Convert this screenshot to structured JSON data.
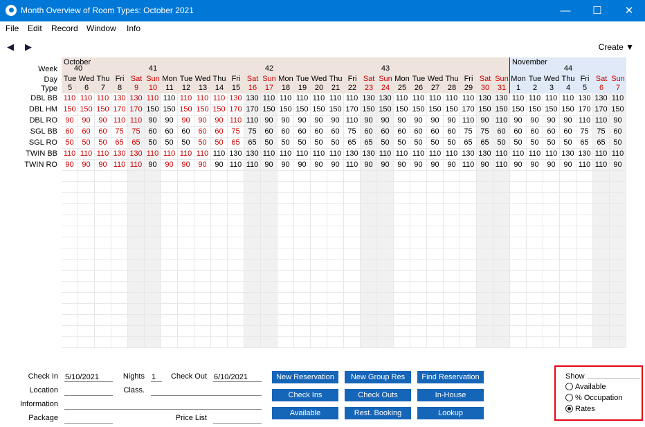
{
  "window": {
    "title": "Month Overview of Room Types: October 2021",
    "minimize": "—",
    "maximize": "☐",
    "close": "✕"
  },
  "menu": [
    "File",
    "Edit",
    "Record",
    "Window",
    "Info"
  ],
  "toolbar": {
    "prev": "◀",
    "next": "▶",
    "create": "Create ▼"
  },
  "grid": {
    "month1": "October",
    "month2": "November",
    "row_labels": {
      "week": "Week",
      "day": "Day",
      "type": "Type"
    },
    "weeks": [
      {
        "label": "40",
        "start": 0,
        "span": 2
      },
      {
        "label": "41",
        "start": 2,
        "span": 7
      },
      {
        "label": "42",
        "start": 9,
        "span": 7
      },
      {
        "label": "43",
        "start": 16,
        "span": 7
      },
      {
        "label": "44",
        "start": 27,
        "span": 7
      }
    ],
    "days": [
      {
        "d": "Tue",
        "n": "5"
      },
      {
        "d": "Wed",
        "n": "6"
      },
      {
        "d": "Thu",
        "n": "7"
      },
      {
        "d": "Fri",
        "n": "8"
      },
      {
        "d": "Sat",
        "n": "9"
      },
      {
        "d": "Sun",
        "n": "10"
      },
      {
        "d": "Mon",
        "n": "11"
      },
      {
        "d": "Tue",
        "n": "12"
      },
      {
        "d": "Wed",
        "n": "13"
      },
      {
        "d": "Thu",
        "n": "14"
      },
      {
        "d": "Fri",
        "n": "15"
      },
      {
        "d": "Sat",
        "n": "16"
      },
      {
        "d": "Sun",
        "n": "17"
      },
      {
        "d": "Mon",
        "n": "18"
      },
      {
        "d": "Tue",
        "n": "19"
      },
      {
        "d": "Wed",
        "n": "20"
      },
      {
        "d": "Thu",
        "n": "21"
      },
      {
        "d": "Fri",
        "n": "22"
      },
      {
        "d": "Sat",
        "n": "23"
      },
      {
        "d": "Sun",
        "n": "24"
      },
      {
        "d": "Mon",
        "n": "25"
      },
      {
        "d": "Tue",
        "n": "26"
      },
      {
        "d": "Wed",
        "n": "27"
      },
      {
        "d": "Thu",
        "n": "28"
      },
      {
        "d": "Fri",
        "n": "29"
      },
      {
        "d": "Sat",
        "n": "30"
      },
      {
        "d": "Sun",
        "n": "31"
      },
      {
        "d": "Mon",
        "n": "1"
      },
      {
        "d": "Tue",
        "n": "2"
      },
      {
        "d": "Wed",
        "n": "3"
      },
      {
        "d": "Thu",
        "n": "4"
      },
      {
        "d": "Fri",
        "n": "5"
      },
      {
        "d": "Sat",
        "n": "6"
      },
      {
        "d": "Sun",
        "n": "7"
      }
    ],
    "weekend_days": [
      4,
      5,
      11,
      12,
      18,
      19,
      25,
      26,
      32,
      33
    ],
    "rooms": [
      {
        "type": "DBL BB",
        "values": [
          "110",
          "110",
          "110",
          "130",
          "130",
          "110",
          "110",
          "110",
          "110",
          "110",
          "130",
          "130",
          "110",
          "110",
          "110",
          "110",
          "110",
          "110",
          "130",
          "130",
          "110",
          "110",
          "110",
          "110",
          "110",
          "130",
          "130",
          "110",
          "110",
          "110",
          "110",
          "130",
          "130",
          "110"
        ],
        "red": [
          0,
          1,
          2,
          3,
          4,
          5,
          7,
          8,
          9,
          10
        ]
      },
      {
        "type": "DBL HM",
        "values": [
          "150",
          "150",
          "150",
          "170",
          "170",
          "150",
          "150",
          "150",
          "150",
          "150",
          "170",
          "170",
          "150",
          "150",
          "150",
          "150",
          "150",
          "170",
          "150",
          "150",
          "150",
          "150",
          "150",
          "150",
          "170",
          "150",
          "150",
          "150",
          "150",
          "150",
          "150",
          "170",
          "170",
          "150"
        ],
        "red": [
          0,
          1,
          2,
          3,
          4,
          7,
          8,
          9,
          10
        ]
      },
      {
        "type": "DBL RO",
        "values": [
          "90",
          "90",
          "90",
          "110",
          "110",
          "90",
          "90",
          "90",
          "90",
          "90",
          "110",
          "110",
          "90",
          "90",
          "90",
          "90",
          "90",
          "110",
          "90",
          "90",
          "90",
          "90",
          "90",
          "90",
          "110",
          "90",
          "110",
          "90",
          "90",
          "90",
          "90",
          "110",
          "110",
          "90"
        ],
        "red": [
          0,
          1,
          2,
          3,
          4,
          7,
          8,
          9,
          10
        ]
      },
      {
        "type": "SGL BB",
        "values": [
          "60",
          "60",
          "60",
          "75",
          "75",
          "60",
          "60",
          "60",
          "60",
          "60",
          "75",
          "75",
          "60",
          "60",
          "60",
          "60",
          "60",
          "75",
          "60",
          "60",
          "60",
          "60",
          "60",
          "60",
          "75",
          "75",
          "60",
          "60",
          "60",
          "60",
          "60",
          "75",
          "75",
          "60"
        ],
        "red": [
          0,
          1,
          2,
          3,
          4,
          8,
          9,
          10
        ]
      },
      {
        "type": "SGL RO",
        "values": [
          "50",
          "50",
          "50",
          "65",
          "65",
          "50",
          "50",
          "50",
          "50",
          "50",
          "65",
          "65",
          "50",
          "50",
          "50",
          "50",
          "50",
          "65",
          "65",
          "50",
          "50",
          "50",
          "50",
          "50",
          "65",
          "65",
          "50",
          "50",
          "50",
          "50",
          "50",
          "65",
          "65",
          "50"
        ],
        "red": [
          0,
          1,
          2,
          3,
          4,
          8,
          9,
          10
        ]
      },
      {
        "type": "TWIN BB",
        "values": [
          "110",
          "110",
          "110",
          "130",
          "130",
          "110",
          "110",
          "110",
          "110",
          "110",
          "130",
          "130",
          "110",
          "110",
          "110",
          "110",
          "110",
          "130",
          "130",
          "110",
          "110",
          "110",
          "110",
          "110",
          "130",
          "130",
          "110",
          "110",
          "110",
          "110",
          "130",
          "130",
          "110",
          "110"
        ],
        "red": [
          0,
          1,
          2,
          3,
          4,
          5,
          6,
          7,
          8
        ]
      },
      {
        "type": "TWIN RO",
        "values": [
          "90",
          "90",
          "90",
          "110",
          "110",
          "90",
          "90",
          "90",
          "90",
          "90",
          "110",
          "110",
          "90",
          "90",
          "90",
          "90",
          "90",
          "110",
          "90",
          "90",
          "90",
          "90",
          "90",
          "90",
          "110",
          "90",
          "110",
          "90",
          "90",
          "90",
          "90",
          "110",
          "110",
          "90"
        ],
        "red": [
          0,
          1,
          2,
          3,
          4,
          6,
          7,
          8
        ]
      }
    ]
  },
  "form": {
    "check_in_label": "Check In",
    "check_in": "5/10/2021",
    "nights_label": "Nights",
    "nights": "1",
    "check_out_label": "Check Out",
    "check_out": "6/10/2021",
    "location_label": "Location",
    "location": "",
    "class_label": "Class.",
    "class": "",
    "information_label": "Information",
    "information": "",
    "package_label": "Package",
    "package": "",
    "price_list_label": "Price List",
    "price_list": ""
  },
  "buttons": {
    "new_reservation": "New Reservation",
    "new_group_res": "New Group Res",
    "find_reservation": "Find Reservation",
    "check_ins": "Check Ins",
    "check_outs": "Check Outs",
    "in_house": "In-House",
    "available": "Available",
    "rest_booking": "Rest. Booking",
    "lookup": "Lookup"
  },
  "show": {
    "title": "Show",
    "options": [
      "Available",
      "% Occupation",
      "Rates"
    ],
    "selected": 2
  }
}
